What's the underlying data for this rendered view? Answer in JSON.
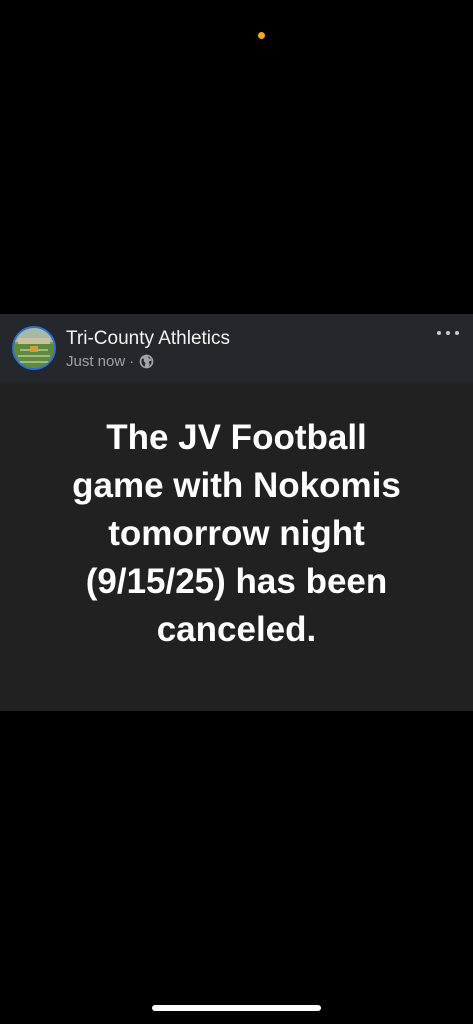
{
  "status_bar": {
    "indicator_color": "#f5a623"
  },
  "post": {
    "page_name": "Tri-County Athletics",
    "timestamp": "Just now",
    "separator": "·",
    "audience_icon": "globe-icon",
    "more_icon": "more-horizontal-icon",
    "avatar_icon": "football-field-avatar",
    "body_text": "The JV Football\ngame with Nokomis\ntomorrow night\n(9/15/25) has been\ncanceled."
  },
  "colors": {
    "background": "#000000",
    "header_bg": "#24272b",
    "body_bg": "#212121",
    "avatar_ring": "#2d6fd6",
    "meta_text": "#9ea3a8"
  }
}
